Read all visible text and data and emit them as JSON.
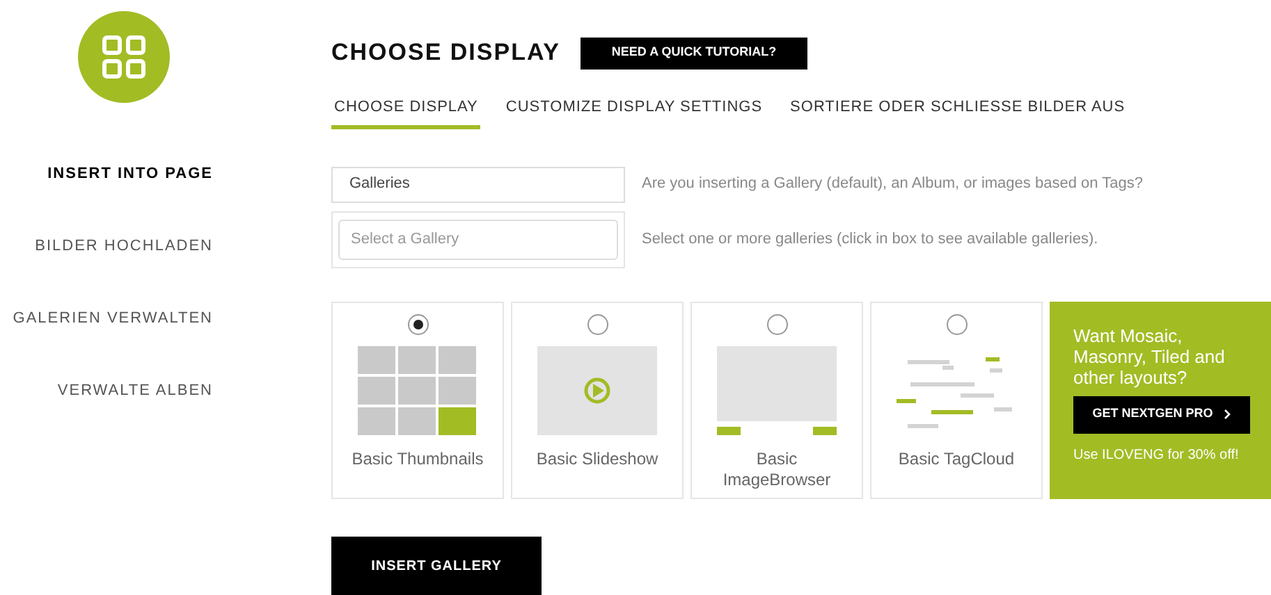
{
  "sidebar": {
    "items": [
      {
        "label": "INSERT INTO PAGE",
        "selected": true
      },
      {
        "label": "BILDER HOCHLADEN",
        "selected": false
      },
      {
        "label": "GALERIEN VERWALTEN",
        "selected": false
      },
      {
        "label": "VERWALTE ALBEN",
        "selected": false
      }
    ]
  },
  "header": {
    "title": "CHOOSE DISPLAY",
    "tutorial_button": "NEED A QUICK TUTORIAL?"
  },
  "tabs": [
    {
      "label": "CHOOSE DISPLAY",
      "selected": true
    },
    {
      "label": "CUSTOMIZE DISPLAY SETTINGS",
      "selected": false
    },
    {
      "label": "SORTIERE ODER SCHLIESSE BILDER AUS",
      "selected": false
    }
  ],
  "source": {
    "value": "Galleries",
    "hint": "Are you inserting a Gallery (default), an Album, or images based on Tags?"
  },
  "gallery_select": {
    "placeholder": "Select a Gallery",
    "hint": "Select one or more galleries (click in box to see available galleries)."
  },
  "display_types": [
    {
      "kind": "thumbnails",
      "label": "Basic Thumbnails",
      "selected": true
    },
    {
      "kind": "slideshow",
      "label": "Basic Slideshow",
      "selected": false
    },
    {
      "kind": "imagebrowser",
      "label": "Basic ImageBrowser",
      "selected": false
    },
    {
      "kind": "tagcloud",
      "label": "Basic TagCloud",
      "selected": false
    }
  ],
  "promo": {
    "text": "Want Mosaic, Masonry, Tiled and other layouts?",
    "button": "GET NEXTGEN PRO",
    "code_note": "Use ILOVENG for 30% off!"
  },
  "insert_button": "INSERT GALLERY"
}
